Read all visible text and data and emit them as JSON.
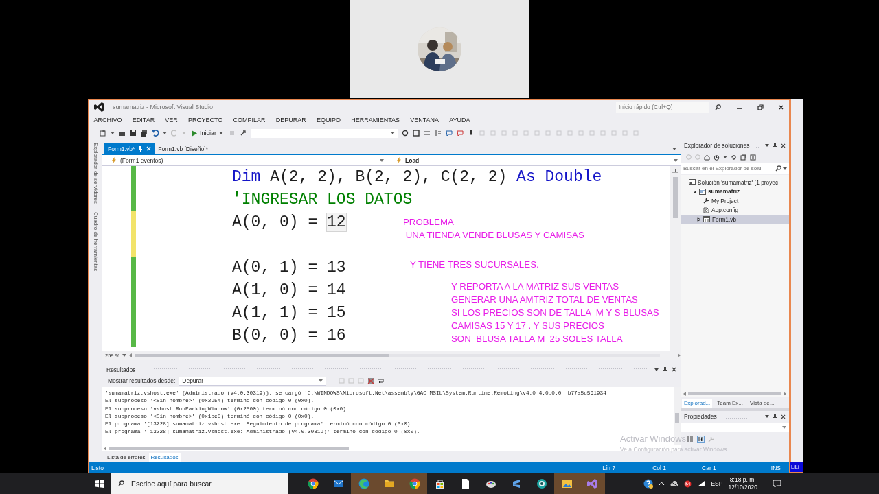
{
  "window": {
    "title": "sumamatriz - Microsoft Visual Studio",
    "quick_launch": {
      "placeholder": "Inicio rápido (Ctrl+Q)"
    }
  },
  "menu": [
    "ARCHIVO",
    "EDITAR",
    "VER",
    "PROYECTO",
    "COMPILAR",
    "DEPURAR",
    "EQUIPO",
    "HERRAMIENTAS",
    "VENTANA",
    "AYUDA"
  ],
  "toolbar": {
    "start_button": "Iniciar"
  },
  "side_strip": [
    "Explorador de servidores",
    "Cuadro de herramientas"
  ],
  "document_tabs": [
    {
      "label": "Form1.vb*",
      "selected": true
    },
    {
      "label": "Form1.vb [Diseño]*",
      "selected": false
    }
  ],
  "navigation": {
    "object": "(Form1 eventos)",
    "member": "Load"
  },
  "code_lines": [
    {
      "kind": "code",
      "saved": true,
      "segments": [
        {
          "kind": "keyword",
          "text": "Dim"
        },
        {
          "kind": "plain",
          "text": " A(2, 2), B(2, 2), C(2, 2) "
        },
        {
          "kind": "keyword",
          "text": "As Double"
        }
      ]
    },
    {
      "kind": "code",
      "saved": true,
      "segments": [
        {
          "kind": "comment",
          "text": "'INGRESAR LOS DATOS"
        }
      ]
    },
    {
      "kind": "code",
      "saved": false,
      "segments": [
        {
          "kind": "plain",
          "text": "A(0, 0) = "
        },
        {
          "kind": "reference",
          "text": "12"
        }
      ]
    },
    {
      "kind": "blank",
      "saved": false
    },
    {
      "kind": "code",
      "saved": true,
      "segments": [
        {
          "kind": "plain",
          "text": "A(0, 1) = 13"
        }
      ]
    },
    {
      "kind": "code",
      "saved": true,
      "segments": [
        {
          "kind": "plain",
          "text": "A(1, 0) = 14"
        }
      ]
    },
    {
      "kind": "code",
      "saved": true,
      "segments": [
        {
          "kind": "plain",
          "text": "A(1, 1) = 15"
        }
      ]
    },
    {
      "kind": "code",
      "saved": true,
      "segments": [
        {
          "kind": "plain",
          "text": "B(0, 0) = 16"
        }
      ]
    }
  ],
  "zoom": "259 %",
  "annotations": [
    {
      "lines": [
        "PROBLEMA",
        " UNA TIENDA VENDE BLUSAS Y CAMISAS"
      ]
    },
    {
      "lines": [
        "Y TIENE TRES SUCURSALES."
      ]
    },
    {
      "lines": [
        "Y REPORTA A LA MATRIZ SUS VENTAS",
        "GENERAR UNA AMTRIZ TOTAL DE VENTAS",
        "SI LOS PRECIOS SON DE TALLA  M Y S BLUSAS",
        "CAMISAS 15 Y 17 . Y SUS PRECIOS",
        "SON  BLUSA TALLA M  25 SOLES TALLA"
      ]
    }
  ],
  "output": {
    "title": "Resultados",
    "source_label": "Mostrar resultados desde:",
    "source": "Depurar",
    "lines": [
      "'sumamatriz.vshost.exe' (Administrado (v4.0.30319)): se cargó 'C:\\WINDOWS\\Microsoft.Net\\assembly\\GAC_MSIL\\System.Runtime.Remoting\\v4.0_4.0.0.0__b77a5c561934",
      "El subproceso '<Sin nombre>' (0x2954) terminó con código 0 (0x0).",
      "El subproceso 'vshost.RunParkingWindow' (0x2500) terminó con código 0 (0x0).",
      "El subproceso '<Sin nombre>' (0x1be8) terminó con código 0 (0x0).",
      "El programa '[13228] sumamatriz.vshost.exe: Seguimiento de programa' terminó con código 0 (0x0).",
      "El programa '[13228] sumamatriz.vshost.exe: Administrado (v4.0.30319)' terminó con código 0 (0x0)."
    ],
    "tabs": [
      {
        "label": "Lista de errores",
        "selected": false
      },
      {
        "label": "Resultados",
        "selected": true
      }
    ]
  },
  "solution_explorer": {
    "title": "Explorador de soluciones",
    "search": {
      "placeholder": "Buscar en el Explorador de solu"
    },
    "tree": [
      {
        "label": "Solución 'sumamatriz' (1 proyec",
        "kind": "solution",
        "selected": false,
        "children": [
          {
            "label": "sumamatriz",
            "kind": "project",
            "expanded": true,
            "selected": false,
            "children": [
              {
                "label": "My Project",
                "kind": "settings",
                "selected": false
              },
              {
                "label": "App.config",
                "kind": "config",
                "selected": false
              },
              {
                "label": "Form1.vb",
                "kind": "form",
                "expanded": false,
                "selected": true
              }
            ]
          }
        ]
      }
    ],
    "tabs": [
      {
        "label": "Explorad...",
        "selected": true
      },
      {
        "label": "Team Ex...",
        "selected": false
      },
      {
        "label": "Vista de...",
        "selected": false
      }
    ]
  },
  "properties": {
    "title": "Propiedades"
  },
  "status_bar": {
    "message": "Listo",
    "line": "Lín 7",
    "column": "Col 1",
    "char": "Car 1",
    "mode": "INS"
  },
  "side_window": {
    "status": "LiLi"
  },
  "activation": {
    "title": "Activar Windows",
    "subtitle": "Ve a Configuración para activar Windows."
  },
  "taskbar": {
    "search": {
      "placeholder": "Escribe aquí para buscar"
    },
    "apps": [
      {
        "kind": "chrome",
        "active": false
      },
      {
        "kind": "mail",
        "active": false
      },
      {
        "kind": "edge",
        "active": true
      },
      {
        "kind": "folder",
        "active": true
      },
      {
        "kind": "chrome",
        "active": true
      },
      {
        "kind": "store",
        "active": false
      },
      {
        "kind": "document",
        "active": false
      },
      {
        "kind": "paint",
        "active": false
      },
      {
        "kind": "sublime",
        "active": false
      },
      {
        "kind": "camera",
        "active": false
      },
      {
        "kind": "photos",
        "active": true
      },
      {
        "kind": "studio",
        "active": true
      }
    ],
    "language": "ESP",
    "time": "8:18 p. m.",
    "date": "12/10/2020"
  }
}
